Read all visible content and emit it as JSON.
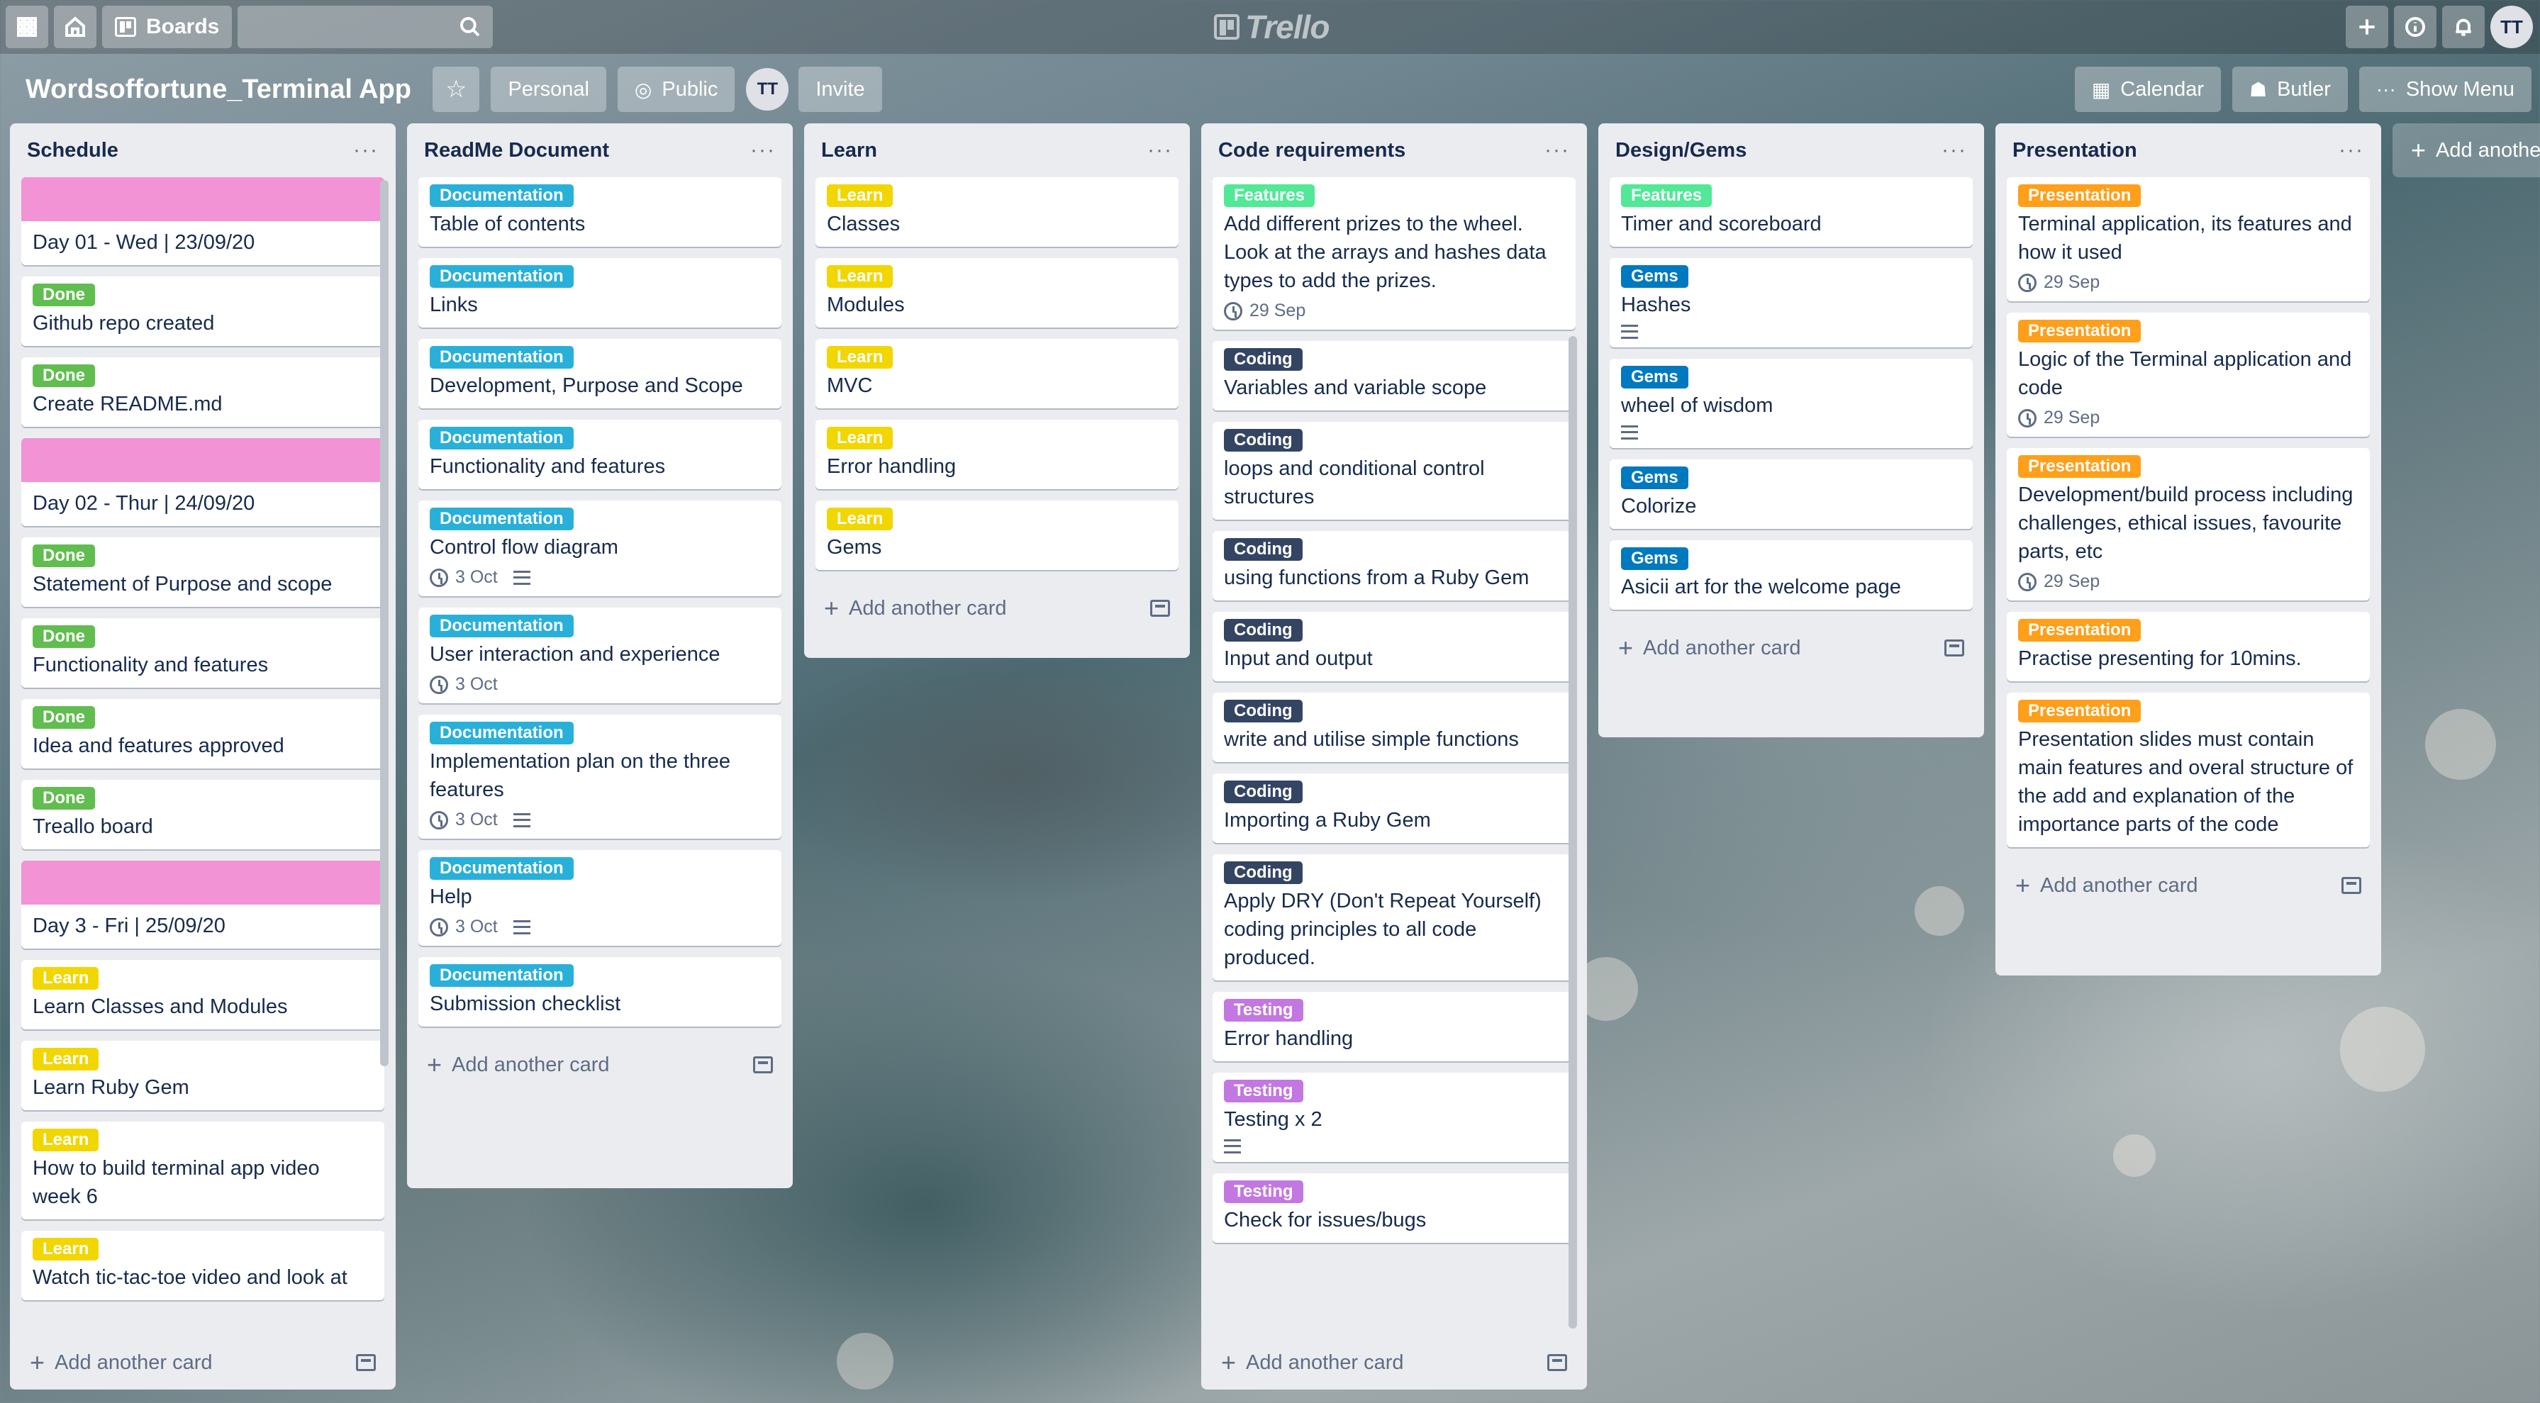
{
  "topbar": {
    "boards_label": "Boards",
    "logo_text": "Trello",
    "user_initials": "TT"
  },
  "board": {
    "title": "Wordsoffortune_Terminal App",
    "personal_label": "Personal",
    "public_label": "Public",
    "member_initials": "TT",
    "invite_label": "Invite",
    "calendar_label": "Calendar",
    "butler_label": "Butler",
    "show_menu_label": "Show Menu",
    "add_list_label": "Add another list"
  },
  "add_card_label": "Add another card",
  "colors": {
    "documentation": "#29b0d9",
    "learn": "#f2d600",
    "done": "#61bd4f",
    "features": "#51e898",
    "coding": "#344563",
    "gems": "#0079bf",
    "testing": "#c377e0",
    "presentation": "#ff9f1a",
    "day_cover": "#f193d4"
  },
  "lists": [
    {
      "title": "Schedule",
      "cards": [
        {
          "cover": true,
          "text": "Day 01 - Wed | 23/09/20"
        },
        {
          "label": "Done",
          "text": "Github repo created"
        },
        {
          "label": "Done",
          "text": "Create README.md"
        },
        {
          "cover": true,
          "text": "Day 02 - Thur | 24/09/20"
        },
        {
          "label": "Done",
          "text": "Statement of Purpose and scope"
        },
        {
          "label": "Done",
          "text": "Functionality and features"
        },
        {
          "label": "Done",
          "text": "Idea and features approved"
        },
        {
          "label": "Done",
          "text": "Treallo board"
        },
        {
          "cover": true,
          "text": "Day 3 - Fri | 25/09/20"
        },
        {
          "label": "Learn",
          "text": "Learn Classes and Modules"
        },
        {
          "label": "Learn",
          "text": "Learn Ruby Gem"
        },
        {
          "label": "Learn",
          "text": "How to build terminal app video week 6"
        },
        {
          "label": "Learn",
          "text": "Watch tic-tac-toe video and look at"
        }
      ]
    },
    {
      "title": "ReadMe Document",
      "cards": [
        {
          "label": "Documentation",
          "text": "Table of contents"
        },
        {
          "label": "Documentation",
          "text": "Links"
        },
        {
          "label": "Documentation",
          "text": "Development, Purpose and Scope"
        },
        {
          "label": "Documentation",
          "text": "Functionality and features"
        },
        {
          "label": "Documentation",
          "text": "Control flow diagram",
          "date": "3 Oct",
          "desc": true
        },
        {
          "label": "Documentation",
          "text": "User interaction and experience",
          "date": "3 Oct"
        },
        {
          "label": "Documentation",
          "text": "Implementation plan on the three features",
          "date": "3 Oct",
          "desc": true
        },
        {
          "label": "Documentation",
          "text": "Help",
          "date": "3 Oct",
          "desc": true
        },
        {
          "label": "Documentation",
          "text": "Submission checklist"
        }
      ]
    },
    {
      "title": "Learn",
      "cards": [
        {
          "label": "Learn",
          "text": "Classes"
        },
        {
          "label": "Learn",
          "text": "Modules"
        },
        {
          "label": "Learn",
          "text": "MVC"
        },
        {
          "label": "Learn",
          "text": "Error handling"
        },
        {
          "label": "Learn",
          "text": "Gems"
        }
      ]
    },
    {
      "title": "Code requirements",
      "cards": [
        {
          "label": "Features",
          "text": "Add different prizes to the wheel. Look at the arrays and hashes data types to add the prizes.",
          "date": "29 Sep"
        },
        {
          "label": "Coding",
          "text": "Variables and variable scope"
        },
        {
          "label": "Coding",
          "text": "loops and conditional control structures"
        },
        {
          "label": "Coding",
          "text": "using functions from a Ruby Gem"
        },
        {
          "label": "Coding",
          "text": "Input and output"
        },
        {
          "label": "Coding",
          "text": "write and utilise simple functions"
        },
        {
          "label": "Coding",
          "text": "Importing a Ruby Gem"
        },
        {
          "label": "Coding",
          "text": "Apply DRY (Don't Repeat Yourself) coding principles to all code produced."
        },
        {
          "label": "Testing",
          "text": "Error handling"
        },
        {
          "label": "Testing",
          "text": "Testing x 2",
          "desc": true
        },
        {
          "label": "Testing",
          "text": "Check for issues/bugs"
        }
      ]
    },
    {
      "title": "Design/Gems",
      "cards": [
        {
          "label": "Features",
          "text": "Timer and scoreboard"
        },
        {
          "label": "Gems",
          "text": "Hashes",
          "desc": true
        },
        {
          "label": "Gems",
          "text": "wheel of wisdom",
          "desc": true
        },
        {
          "label": "Gems",
          "text": "Colorize"
        },
        {
          "label": "Gems",
          "text": "Asicii art for the welcome page"
        }
      ]
    },
    {
      "title": "Presentation",
      "cards": [
        {
          "label": "Presentation",
          "text": "Terminal application, its features and how it used",
          "date": "29 Sep"
        },
        {
          "label": "Presentation",
          "text": "Logic of the Terminal application and code",
          "date": "29 Sep"
        },
        {
          "label": "Presentation",
          "text": "Development/build process including challenges, ethical issues, favourite parts, etc",
          "date": "29 Sep"
        },
        {
          "label": "Presentation",
          "text": "Practise presenting for 10mins."
        },
        {
          "label": "Presentation",
          "text": "Presentation slides must contain main features and overal structure of the add and explanation of the importance parts of the code"
        }
      ]
    }
  ]
}
